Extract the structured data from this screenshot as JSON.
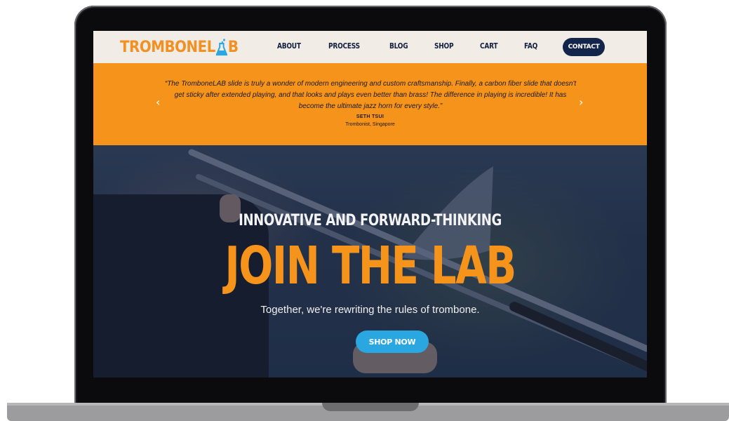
{
  "nav": {
    "logo_left": "TROMBONEL",
    "logo_right": "B",
    "items": [
      "ABOUT",
      "PROCESS",
      "BLOG",
      "SHOP",
      "CART",
      "FAQ"
    ],
    "contact_label": "CONTACT"
  },
  "testimonial": {
    "quote": "“The TromboneLAB slide is truly a wonder of modern engineering and custom craftsmanship. Finally, a carbon fiber slide that doesn't get sticky after extended playing, and that looks and plays even better than brass! The difference in playing is incredible! It has become the ultimate jazz horn for every style.”",
    "author": "SETH TSUI",
    "author_role": "Trombonist, Singapore",
    "prev_icon": "chevron-left-icon",
    "next_icon": "chevron-right-icon"
  },
  "hero": {
    "kicker": "INNOVATIVE AND FORWARD-THINKING",
    "title": "JOIN THE LAB",
    "subtitle": "Together, we're rewriting the rules of trombone.",
    "cta": "SHOP NOW"
  },
  "colors": {
    "brand_orange": "#f6931b",
    "navy": "#13254a",
    "cta_blue": "#2aa7e0",
    "nav_bg": "#f1ece6"
  }
}
